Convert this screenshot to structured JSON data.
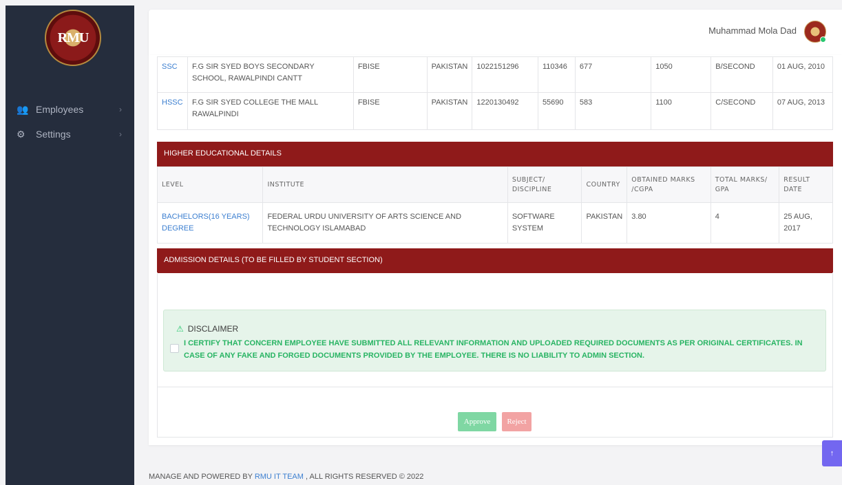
{
  "user": {
    "name": "Muhammad Mola Dad"
  },
  "logo": {
    "text": "RMU"
  },
  "sidebar": {
    "items": [
      {
        "label": "Employees",
        "icon": "users-icon"
      },
      {
        "label": "Settings",
        "icon": "gear-icon"
      }
    ]
  },
  "secondary": {
    "rows": [
      {
        "level": "SSC",
        "institute": "F.G SIR SYED BOYS SECONDARY SCHOOL, RAWALPINDI CANTT",
        "board": "FBISE",
        "country": "PAKISTAN",
        "roll": "1022151296",
        "reg": "110346",
        "obtained": "677",
        "total": "1050",
        "grade": "B/SECOND",
        "date": "01 AUG, 2010"
      },
      {
        "level": "HSSC",
        "institute": "F.G SIR SYED COLLEGE THE MALL RAWALPINDI",
        "board": "FBISE",
        "country": "PAKISTAN",
        "roll": "1220130492",
        "reg": "55690",
        "obtained": "583",
        "total": "1100",
        "grade": "C/SECOND",
        "date": "07 AUG, 2013"
      }
    ]
  },
  "higher": {
    "title": "HIGHER EDUCATIONAL DETAILS",
    "headers": {
      "level": "LEVEL",
      "institute": "INSTITUTE",
      "subject": "SUBJECT/ DISCIPLINE",
      "country": "COUNTRY",
      "obtained": "OBTAINED MARKS /CGPA",
      "total": "TOTAL MARKS/ GPA",
      "date": "RESULT DATE"
    },
    "rows": [
      {
        "level": "BACHELORS(16 YEARS) DEGREE",
        "institute": "FEDERAL URDU UNIVERSITY OF ARTS SCIENCE AND TECHNOLOGY ISLAMABAD",
        "subject": "SOFTWARE SYSTEM",
        "country": "PAKISTAN",
        "obtained": "3.80",
        "total": "4",
        "date": "25 AUG, 2017"
      }
    ]
  },
  "admission": {
    "title": "ADMISSION DETAILS (TO BE FILLED BY STUDENT SECTION)",
    "disclaimer_title": "DISCLAIMER",
    "disclaimer_text": "I CERTIFY THAT CONCERN EMPLOYEE HAVE SUBMITTED ALL RELEVANT INFORMATION AND UPLOADED REQUIRED DOCUMENTS AS PER ORIGINAL CERTIFICATES. IN CASE OF ANY FAKE AND FORGED DOCUMENTS PROVIDED BY THE EMPLOYEE. THERE IS NO LIABILITY TO ADMIN SECTION.",
    "approve_label": "Approve",
    "reject_label": "Reject"
  },
  "footer": {
    "prefix": "MANAGE AND POWERED BY ",
    "link": "RMU IT TEAM",
    "suffix": " , ALL RIGHTS RESERVED © 2022"
  },
  "colors": {
    "sidebar": "#252d3d",
    "header": "#8f1a1a",
    "approve": "#7fd7a3",
    "reject": "#f2a3a3",
    "success_text": "#28b463",
    "scroll_button": "#7367f0"
  }
}
